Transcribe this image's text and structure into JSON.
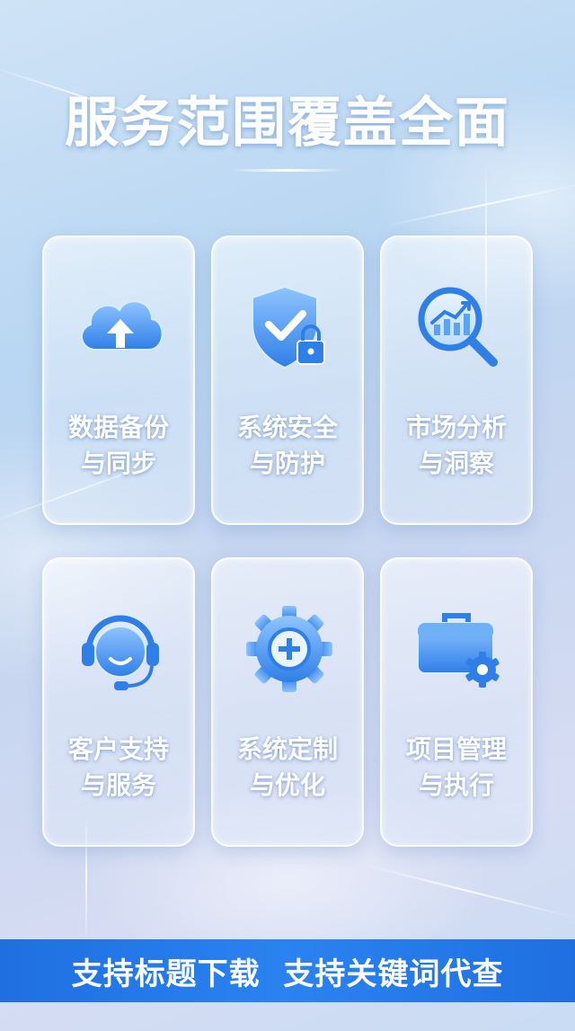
{
  "title": "服务范围覆盖全面",
  "cards": [
    {
      "line1": "数据备份",
      "line2": "与同步",
      "icon": "cloud-upload-icon"
    },
    {
      "line1": "系统安全",
      "line2": "与防护",
      "icon": "shield-lock-icon"
    },
    {
      "line1": "市场分析",
      "line2": "与洞察",
      "icon": "magnifier-chart-icon"
    },
    {
      "line1": "客户支持",
      "line2": "与服务",
      "icon": "headset-icon"
    },
    {
      "line1": "系统定制",
      "line2": "与优化",
      "icon": "gear-plus-icon"
    },
    {
      "line1": "项目管理",
      "line2": "与执行",
      "icon": "briefcase-gear-icon"
    }
  ],
  "banner": {
    "text": "支持标题下载  支持关键词代查"
  },
  "colors": {
    "accent": "#1f6fe0",
    "icon_blue": "#3a8ef0"
  }
}
